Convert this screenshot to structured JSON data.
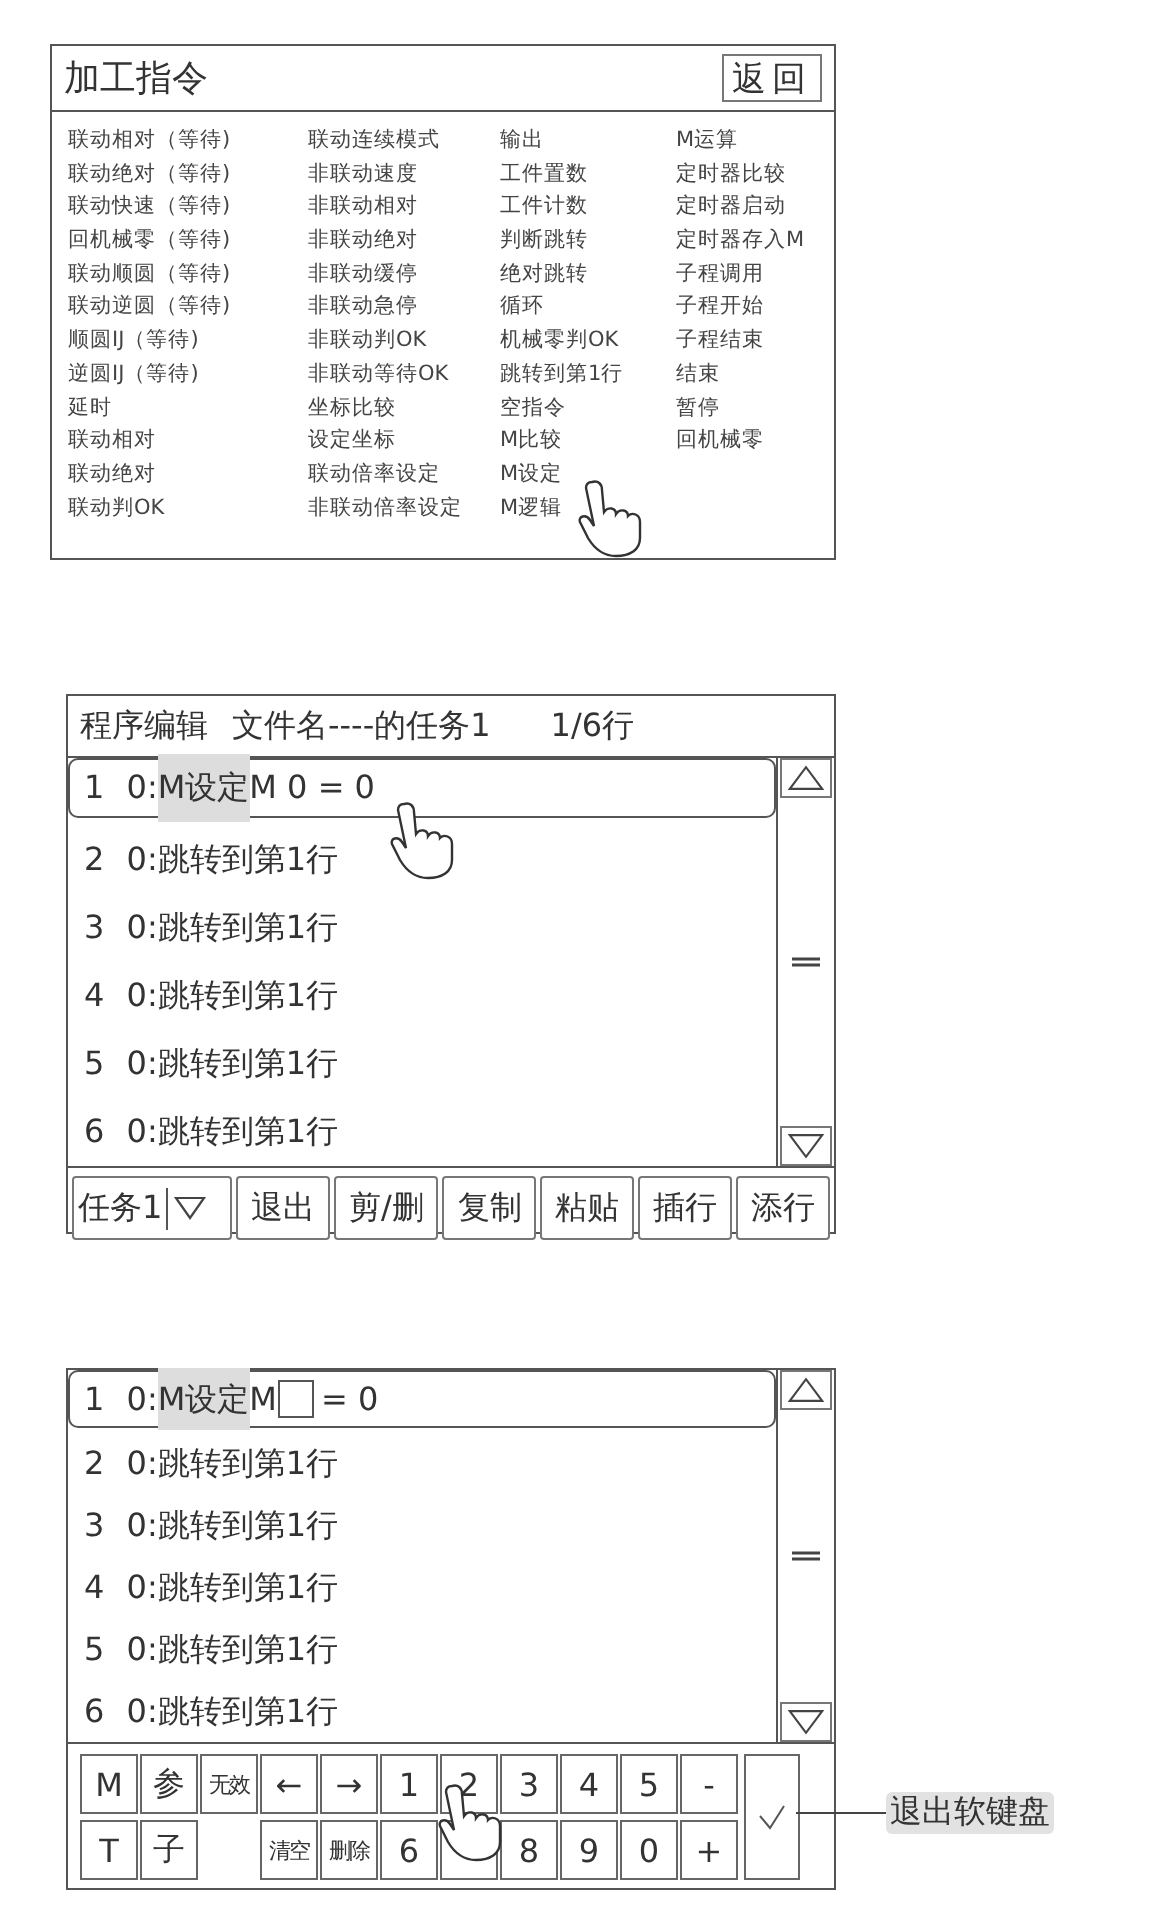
{
  "command_panel": {
    "title": "加工指令",
    "back_button": "返回",
    "columns": [
      [
        "联动相对（等待)",
        "联动绝对（等待)",
        "联动快速（等待)",
        "回机械零（等待)",
        "联动顺圆（等待)",
        "联动逆圆（等待)",
        "顺圆IJ（等待)",
        "逆圆IJ（等待)",
        "延时",
        "联动相对",
        "联动绝对",
        "联动判OK"
      ],
      [
        "联动连续模式",
        "非联动速度",
        "非联动相对",
        "非联动绝对",
        "非联动缓停",
        "非联动急停",
        "非联动判OK",
        "非联动等待OK",
        "坐标比较",
        "设定坐标",
        "联动倍率设定",
        "非联动倍率设定"
      ],
      [
        "输出",
        "工件置数",
        "工件计数",
        "判断跳转",
        "绝对跳转",
        "循环",
        "机械零判OK",
        "跳转到第1行",
        "空指令",
        "M比较",
        "M设定",
        "M逻辑"
      ],
      [
        "M运算",
        "定时器比较",
        "定时器启动",
        "定时器存入M",
        "子程调用",
        "子程开始",
        "子程结束",
        "结束",
        "暂停",
        "回机械零"
      ]
    ]
  },
  "program_editor": {
    "title": "程序编辑",
    "file": "文件名----的任务1",
    "position": "1/6行",
    "rows": [
      {
        "num": "1",
        "prefix": "0:",
        "highlight": "M设定",
        "rest": " M 0 = 0",
        "selected": true
      },
      {
        "num": "2",
        "prefix": "0:",
        "rest": "跳转到第1行",
        "selected": false
      },
      {
        "num": "3",
        "prefix": "0:",
        "rest": "跳转到第1行",
        "selected": false
      },
      {
        "num": "4",
        "prefix": "0:",
        "rest": "跳转到第1行",
        "selected": false
      },
      {
        "num": "5",
        "prefix": "0:",
        "rest": "跳转到第1行",
        "selected": false
      },
      {
        "num": "6",
        "prefix": "0:",
        "rest": "跳转到第1行",
        "selected": false
      }
    ],
    "task_dropdown": "任务1",
    "buttons": [
      "退出",
      "剪/删",
      "复制",
      "粘贴",
      "插行",
      "添行"
    ]
  },
  "keypad_editor": {
    "rows": [
      {
        "num": "1",
        "prefix": "0:",
        "highlight": "M设定",
        "rest": " M",
        "input": true,
        "after": "= 0",
        "selected": true
      },
      {
        "num": "2",
        "prefix": "0:",
        "rest": "跳转到第1行",
        "selected": false
      },
      {
        "num": "3",
        "prefix": "0:",
        "rest": "跳转到第1行",
        "selected": false
      },
      {
        "num": "4",
        "prefix": "0:",
        "rest": "跳转到第1行",
        "selected": false
      },
      {
        "num": "5",
        "prefix": "0:",
        "rest": "跳转到第1行",
        "selected": false
      },
      {
        "num": "6",
        "prefix": "0:",
        "rest": "跳转到第1行",
        "selected": false
      }
    ],
    "keys": [
      [
        {
          "kind": "key",
          "label": "M"
        },
        {
          "kind": "key",
          "label": "参"
        },
        {
          "kind": "small",
          "label": "无效"
        },
        {
          "kind": "key",
          "label": "←"
        },
        {
          "kind": "key",
          "label": "→"
        },
        {
          "kind": "key",
          "label": "1"
        },
        {
          "kind": "key",
          "label": "2"
        },
        {
          "kind": "key",
          "label": "3"
        },
        {
          "kind": "key",
          "label": "4"
        },
        {
          "kind": "key",
          "label": "5"
        },
        {
          "kind": "key",
          "label": "-"
        }
      ],
      [
        {
          "kind": "key",
          "label": "T"
        },
        {
          "kind": "key",
          "label": "子"
        },
        {
          "kind": "gap"
        },
        {
          "kind": "small",
          "label": "清空"
        },
        {
          "kind": "small",
          "label": "删除"
        },
        {
          "kind": "key",
          "label": "6"
        },
        {
          "kind": "covered"
        },
        {
          "kind": "key",
          "label": "8"
        },
        {
          "kind": "key",
          "label": "9"
        },
        {
          "kind": "key",
          "label": "0"
        },
        {
          "kind": "key",
          "label": "+"
        }
      ]
    ],
    "callout": "退出软键盘"
  }
}
